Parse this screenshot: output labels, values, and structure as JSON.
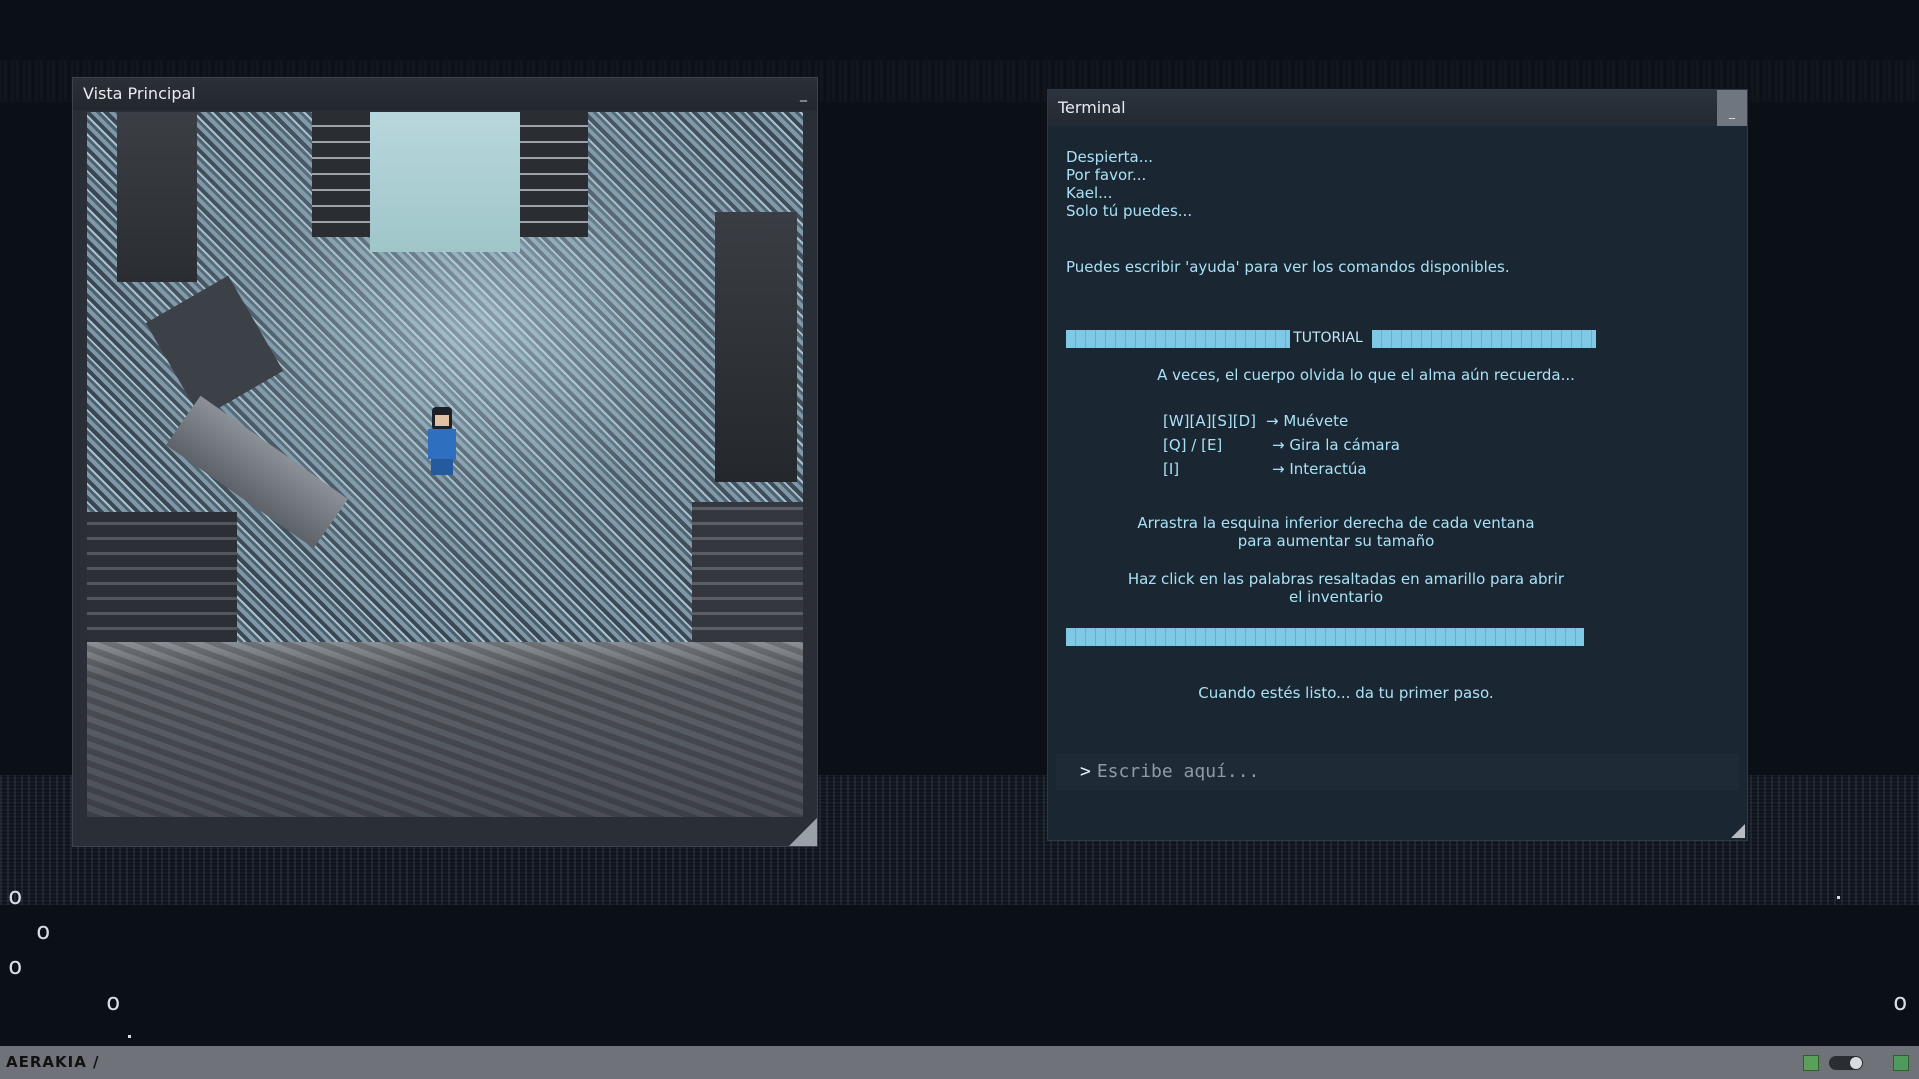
{
  "game_window": {
    "title": "Vista Principal",
    "minimize_label": "_"
  },
  "terminal": {
    "title": "Terminal",
    "minimize_label": "_",
    "intro_lines": [
      "Despierta...",
      "Por favor...",
      "Kael...",
      "Solo tú puedes..."
    ],
    "help_line": "Puedes escribir 'ayuda' para ver los comandos disponibles.",
    "tutorial_label": "TUTORIAL",
    "tutorial_quote": "A veces, el cuerpo olvida lo que el alma aún recuerda...",
    "controls": [
      {
        "keys": "[W][A][S][D]",
        "action": "→ Muévete"
      },
      {
        "keys": "[Q] / [E]",
        "action": "→ Gira la cámara"
      },
      {
        "keys": "[I]",
        "action": "→ Interactúa"
      }
    ],
    "resize_hint_1": "Arrastra la esquina inferior derecha de cada ventana",
    "resize_hint_2": "para aumentar su tamaño",
    "click_hint_1": "Haz click en las palabras resaltadas en amarillo para abrir",
    "click_hint_2": "el inventario",
    "ready_line": "Cuando estés listo... da tu primer paso.",
    "input_prompt": ">",
    "input_placeholder": "Escribe aquí..."
  },
  "floating_glyphs": [
    "o",
    "o",
    "o",
    "o",
    "o"
  ],
  "statusbar": {
    "brand": "AERAKIA /"
  },
  "colors": {
    "background": "#0b0f16",
    "terminal_text": "#a9e1f5",
    "tutorial_bar": "#7fc8e6",
    "statusbar": "#6f7379"
  }
}
